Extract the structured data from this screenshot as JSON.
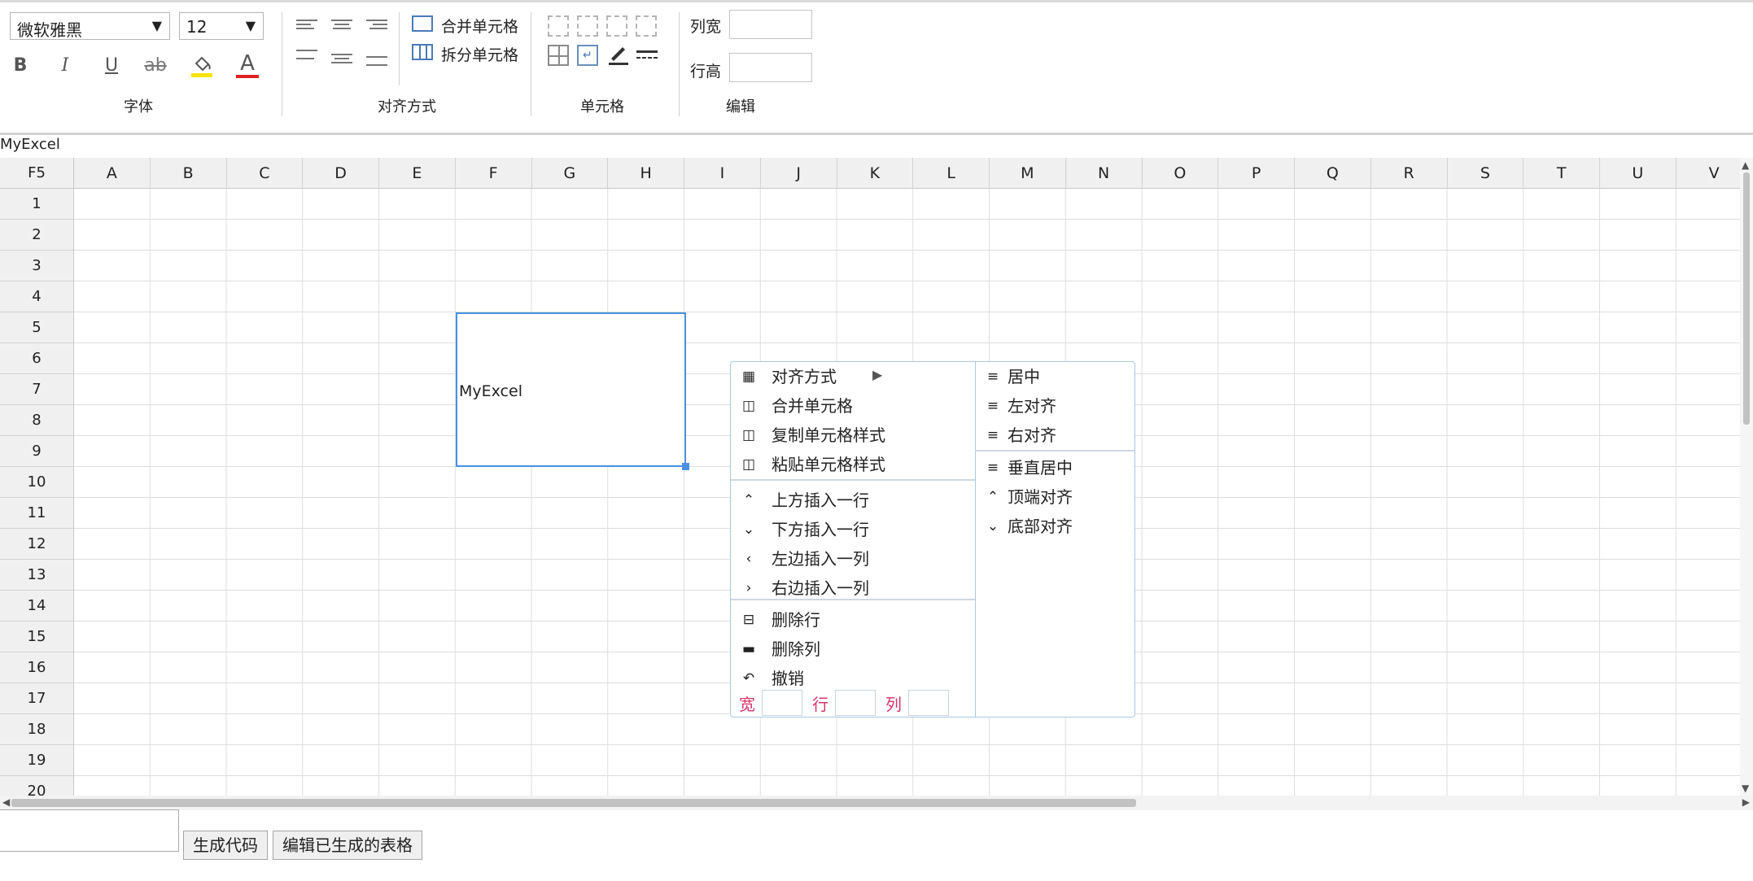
{
  "toolbar": {
    "font_family": "微软雅黑",
    "font_size": "12",
    "bold_label": "B",
    "italic_label": "I",
    "underline_label": "U",
    "strike_label": "ab",
    "font_color_label": "A",
    "highlight_color": "#f5e30a",
    "font_color": "#e02020",
    "merge_label": "合并单元格",
    "split_label": "拆分单元格",
    "col_width_label": "列宽",
    "row_height_label": "行高",
    "col_width_value": "",
    "row_height_value": "",
    "groups": {
      "font": "字体",
      "align": "对齐方式",
      "cell": "单元格",
      "edit": "编辑"
    }
  },
  "formula_bar": {
    "text": "MyExcel"
  },
  "sheet": {
    "name_box": "F5",
    "columns": [
      "A",
      "B",
      "C",
      "D",
      "E",
      "F",
      "G",
      "H",
      "I",
      "J",
      "K",
      "L",
      "M",
      "N",
      "O",
      "P",
      "Q",
      "R",
      "S",
      "T",
      "U",
      "V"
    ],
    "rows": [
      "1",
      "2",
      "3",
      "4",
      "5",
      "6",
      "7",
      "8",
      "9",
      "10",
      "11",
      "12",
      "13",
      "14",
      "15",
      "16",
      "17",
      "18",
      "19",
      "20"
    ],
    "selected_cell_text": "MyExcel",
    "selection_color": "#4a8fe0"
  },
  "context_menu": {
    "left": [
      {
        "icon": "grid-dots-icon",
        "glyph": "▦",
        "label": "对齐方式"
      },
      {
        "icon": "merge-cell-icon",
        "glyph": "◫",
        "label": "合并单元格"
      },
      {
        "icon": "copy-style-icon",
        "glyph": "◫",
        "label": "复制单元格样式"
      },
      {
        "icon": "paste-style-icon",
        "glyph": "◫",
        "label": "粘贴单元格样式"
      },
      {
        "icon": "chevron-up-icon",
        "glyph": "⌃",
        "label": "上方插入一行"
      },
      {
        "icon": "chevron-down-icon",
        "glyph": "⌄",
        "label": "下方插入一行"
      },
      {
        "icon": "chevron-left-icon",
        "glyph": "‹",
        "label": "左边插入一列"
      },
      {
        "icon": "chevron-right-icon",
        "glyph": "›",
        "label": "右边插入一列"
      },
      {
        "icon": "minus-square-icon",
        "glyph": "⊟",
        "label": "删除行"
      },
      {
        "icon": "minus-square-filled-icon",
        "glyph": "▬",
        "label": "删除列"
      },
      {
        "icon": "undo-icon",
        "glyph": "↶",
        "label": "撤销"
      }
    ],
    "sub": [
      {
        "icon": "align-center-icon",
        "glyph": "≡",
        "label": "居中"
      },
      {
        "icon": "align-left-icon",
        "glyph": "≡",
        "label": "左对齐"
      },
      {
        "icon": "align-right-icon",
        "glyph": "≡",
        "label": "右对齐"
      },
      {
        "icon": "align-middle-icon",
        "glyph": "≡",
        "label": "垂直居中"
      },
      {
        "icon": "align-top-icon",
        "glyph": "⌃",
        "label": "顶端对齐"
      },
      {
        "icon": "align-bottom-icon",
        "glyph": "⌄",
        "label": "底部对齐"
      }
    ],
    "size_inputs": [
      {
        "label": "宽",
        "value": ""
      },
      {
        "label": "行",
        "value": ""
      },
      {
        "label": "列",
        "value": ""
      }
    ]
  },
  "bottom": {
    "generate_label": "生成代码",
    "edit_generated_label": "编辑已生成的表格"
  }
}
